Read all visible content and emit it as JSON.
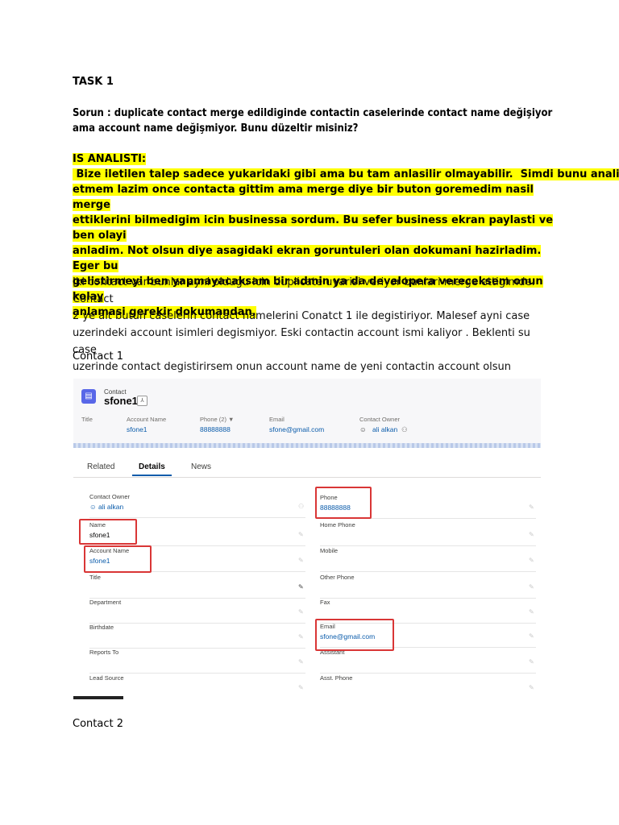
{
  "task_title": "TASK 1",
  "problem_lines": [
    "Sorun : duplicate contact merge edildiginde contactin caselerinde contact name değişiyor",
    "ama account name değişmiyor. Bunu düzeltir misiniz?"
  ],
  "analyst_title": "IS ANALISTI:",
  "analyst_lines": [
    " Bize iletilen talep sadece yukaridaki gibi ama bu tam anlasilir olmayabilir.  Simdi bunu analiz",
    "etmem lazim once contacta gittim ama merge diye bir buton goremedim nasil merge",
    "ettiklerini bilmedigim icin businessa sordum. Bu sefer business ekran paylasti ve ben olayi",
    "anladim. Not olsun diye asagidaki ekran goruntuleri olan dokumani hazirladim. Eger bu",
    "gelistirmeyi ben yapmayacaksam bir admin ya da developera vereceksem onun kolay",
    "anlamasi gerekir dokumandan."
  ],
  "paragraph_lines": [
    "Iki contact var bunlar ayni oldugu icin duplicate uyarisi veriyor bunlari merge ettigimde. Contact",
    "2 ye ait butun caselerin contact namelerini Conatct 1 ile degistiriyor. Malesef ayni case",
    "uzerindeki account isimleri degismiyor. Eski contactin account ismi kaliyor . Beklenti su case",
    "uzerinde contact degistirirsem onun account name de yeni contactin account olsun"
  ],
  "contact1_label": "Contact 1",
  "contact2_label": "Contact 2",
  "sf": {
    "object_label": "Contact",
    "record_name": "sfone1",
    "header_fields": [
      {
        "label": "Title",
        "value": ""
      },
      {
        "label": "Account Name",
        "value": "sfone1"
      },
      {
        "label": "Phone (2) ▼",
        "value": "88888888"
      },
      {
        "label": "Email",
        "value": "sfone@gmail.com"
      },
      {
        "label": "Contact Owner",
        "value": "ali alkan"
      }
    ],
    "tabs": [
      "Related",
      "Details",
      "News"
    ],
    "active_tab": "Details",
    "left_fields": [
      {
        "label": "Contact Owner",
        "value": "ali alkan"
      },
      {
        "label": "Name",
        "value": "sfone1"
      },
      {
        "label": "Account Name",
        "value": "sfone1"
      },
      {
        "label": "Title",
        "value": ""
      },
      {
        "label": "Department",
        "value": ""
      },
      {
        "label": "Birthdate",
        "value": ""
      },
      {
        "label": "Reports To",
        "value": ""
      },
      {
        "label": "Lead Source",
        "value": ""
      }
    ],
    "right_fields": [
      {
        "label": "Phone",
        "value": "88888888"
      },
      {
        "label": "Home Phone",
        "value": ""
      },
      {
        "label": "Mobile",
        "value": ""
      },
      {
        "label": "Other Phone",
        "value": ""
      },
      {
        "label": "Fax",
        "value": ""
      },
      {
        "label": "Email",
        "value": "sfone@gmail.com"
      },
      {
        "label": "Assistant",
        "value": ""
      },
      {
        "label": "Asst. Phone",
        "value": ""
      }
    ],
    "highlight_color": "#d93636",
    "link_color": "#0b5cab"
  }
}
